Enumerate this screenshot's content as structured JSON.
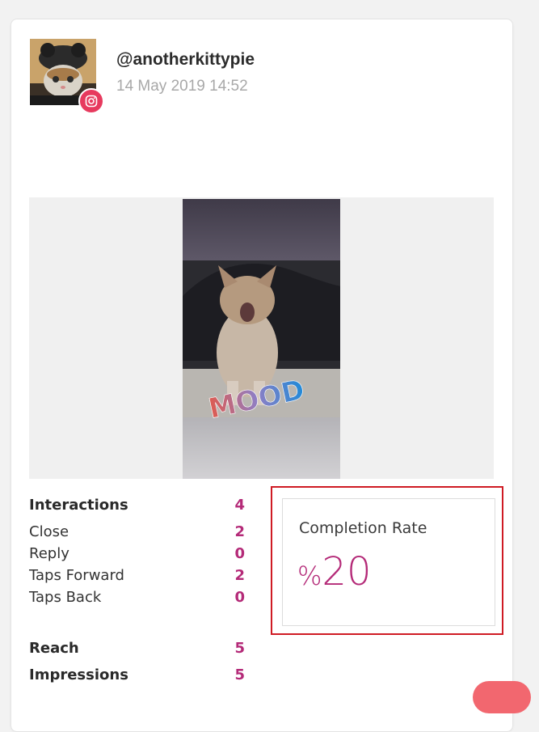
{
  "post": {
    "username": "@anotherkittypie",
    "timestamp": "14 May 2019 14:52",
    "platform_icon": "instagram-icon",
    "story_sticker_text": "MOOD"
  },
  "interactions": {
    "label": "Interactions",
    "value": "4",
    "items": [
      {
        "label": "Close",
        "value": "2"
      },
      {
        "label": "Reply",
        "value": "0"
      },
      {
        "label": "Taps Forward",
        "value": "2"
      },
      {
        "label": "Taps Back",
        "value": "0"
      }
    ]
  },
  "reach": {
    "label": "Reach",
    "value": "5"
  },
  "impressions": {
    "label": "Impressions",
    "value": "5"
  },
  "completion": {
    "title": "Completion Rate",
    "symbol": "%",
    "value": "20"
  },
  "colors": {
    "accent": "#b42a78",
    "instagram": "#e73a5e",
    "highlight": "#cf1b24",
    "fab": "#f2676f"
  }
}
